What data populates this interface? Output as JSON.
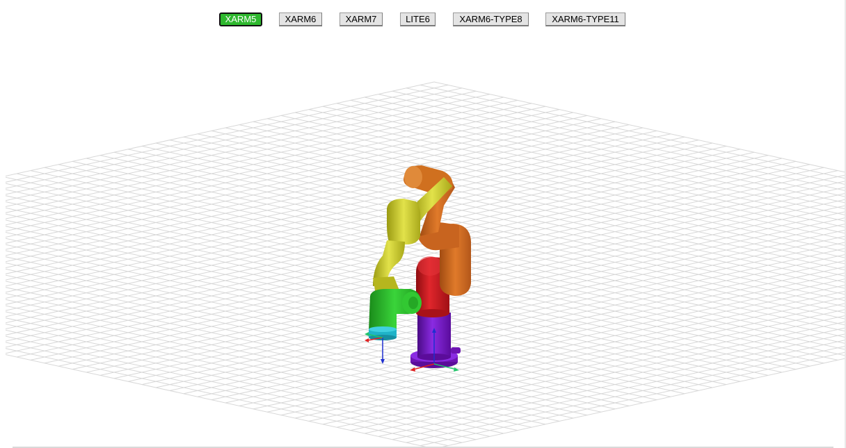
{
  "toolbar": {
    "models": [
      {
        "label": "XARM5",
        "active": true
      },
      {
        "label": "XARM6",
        "active": false
      },
      {
        "label": "XARM7",
        "active": false
      },
      {
        "label": "LITE6",
        "active": false
      },
      {
        "label": "XARM6-TYPE8",
        "active": false
      },
      {
        "label": "XARM6-TYPE11",
        "active": false
      }
    ]
  },
  "scene": {
    "background": "#ffffff",
    "grid_color": "#d7d7d7",
    "link_colors": {
      "base": "#6a0dad",
      "link1": "#c4161c",
      "link2": "#d2691e",
      "link3": "#c9c92a",
      "link4": "#2cb82c",
      "flange": "#1fb3c8"
    },
    "axis_colors": {
      "x": "#e02020",
      "y": "#22c46a",
      "z": "#1f2fd0"
    }
  }
}
